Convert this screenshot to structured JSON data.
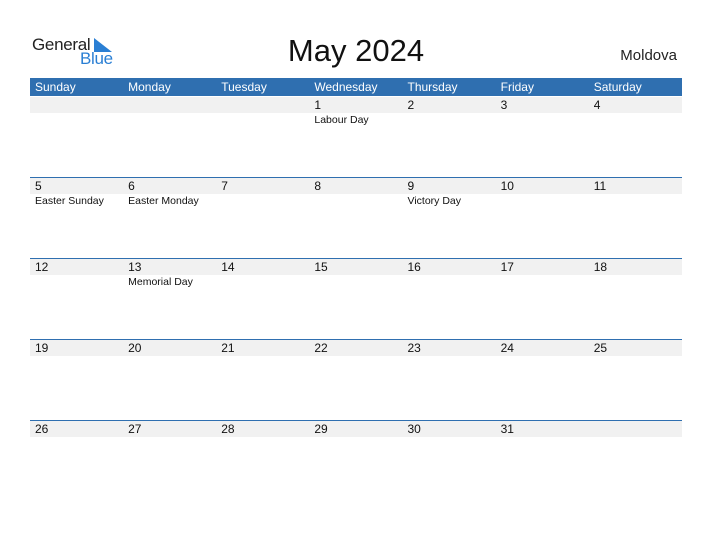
{
  "logo": {
    "text_general": "General",
    "text_blue": "Blue",
    "icon": "triangle-flag-icon",
    "accent": "#2a7fd4"
  },
  "title": "May 2024",
  "country": "Moldova",
  "colors": {
    "header_bg": "#2f6fb0",
    "date_row_bg": "#f1f1f1"
  },
  "weekdays": [
    "Sunday",
    "Monday",
    "Tuesday",
    "Wednesday",
    "Thursday",
    "Friday",
    "Saturday"
  ],
  "weeks": [
    {
      "days": [
        "",
        "",
        "",
        "1",
        "2",
        "3",
        "4"
      ],
      "events": [
        "",
        "",
        "",
        "Labour Day",
        "",
        "",
        ""
      ]
    },
    {
      "days": [
        "5",
        "6",
        "7",
        "8",
        "9",
        "10",
        "11"
      ],
      "events": [
        "Easter Sunday",
        "Easter Monday",
        "",
        "",
        "Victory Day",
        "",
        ""
      ]
    },
    {
      "days": [
        "12",
        "13",
        "14",
        "15",
        "16",
        "17",
        "18"
      ],
      "events": [
        "",
        "Memorial Day",
        "",
        "",
        "",
        "",
        ""
      ]
    },
    {
      "days": [
        "19",
        "20",
        "21",
        "22",
        "23",
        "24",
        "25"
      ],
      "events": [
        "",
        "",
        "",
        "",
        "",
        "",
        ""
      ]
    },
    {
      "days": [
        "26",
        "27",
        "28",
        "29",
        "30",
        "31",
        ""
      ],
      "events": [
        "",
        "",
        "",
        "",
        "",
        "",
        ""
      ]
    }
  ]
}
